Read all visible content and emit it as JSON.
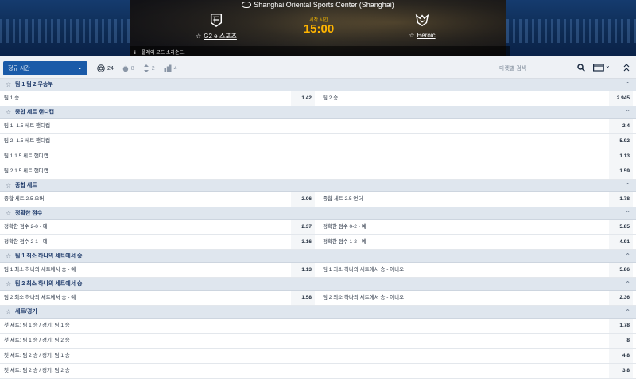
{
  "event": {
    "venue": "Shanghai Oriental Sports Center (Shanghai)",
    "home_team": "G2 e 스포츠",
    "away_team": "Heroic",
    "start_label": "시작 시간",
    "start_time": "15:00",
    "notice": "플레이 모드 소라순드."
  },
  "toolbar": {
    "period": "정규 시간",
    "filters": [
      {
        "count": "24",
        "icon": "target-icon"
      },
      {
        "count": "8",
        "icon": "fire-icon"
      },
      {
        "count": "2",
        "icon": "swap-icon"
      },
      {
        "count": "4",
        "icon": "ladder-icon"
      }
    ],
    "search_placeholder": "마켓별 검색"
  },
  "markets": [
    {
      "title": "팀 1 팀 2 무승부",
      "rows": [
        {
          "left_label": "팀 1 승",
          "left_odd": "1.42",
          "right_label": "팀 2 승",
          "right_odd": "2.945"
        }
      ]
    },
    {
      "title": "종합 세트 핸디캡",
      "rows": [
        {
          "label": "팀 1 -1.5 세트 핸디캡",
          "odd": "2.4"
        },
        {
          "label": "팀 2 -1.5 세트 핸디캡",
          "odd": "5.92"
        },
        {
          "label": "팀 1 1.5 세트 핸디캡",
          "odd": "1.13"
        },
        {
          "label": "팀 2 1.5 세트 핸디캡",
          "odd": "1.59"
        }
      ]
    },
    {
      "title": "종합 세트",
      "rows": [
        {
          "left_label": "종합 세트 2.5 오버",
          "left_odd": "2.06",
          "right_label": "종합 세트 2.5 언더",
          "right_odd": "1.78"
        }
      ]
    },
    {
      "title": "정확한 점수",
      "rows": [
        {
          "left_label": "정확한 점수 2-0 - 예",
          "left_odd": "2.37",
          "right_label": "정확한 점수 0-2 - 예",
          "right_odd": "5.85"
        },
        {
          "left_label": "정확한 점수 2-1 - 예",
          "left_odd": "3.16",
          "right_label": "정확한 점수 1-2 - 예",
          "right_odd": "4.91"
        }
      ]
    },
    {
      "title": "팀 1 최소 하나의 세트에서 승",
      "rows": [
        {
          "left_label": "팀 1 최소 하나의 세트에서 승 - 예",
          "left_odd": "1.13",
          "right_label": "팀 1 최소 하나의 세트에서 승 - 아니오",
          "right_odd": "5.86"
        }
      ]
    },
    {
      "title": "팀 2 최소 하나의 세트에서 승",
      "rows": [
        {
          "left_label": "팀 2 최소 하나의 세트에서 승 - 예",
          "left_odd": "1.58",
          "right_label": "팀 2 최소 하나의 세트에서 승 - 아니오",
          "right_odd": "2.36"
        }
      ]
    },
    {
      "title": "세트/경기",
      "rows": [
        {
          "label": "첫 세트: 팀 1 승 / 경기: 팀 1 승",
          "odd": "1.78"
        },
        {
          "label": "첫 세트: 팀 1 승 / 경기: 팀 2 승",
          "odd": "8"
        },
        {
          "label": "첫 세트: 팀 2 승 / 경기: 팀 1 승",
          "odd": "4.8"
        },
        {
          "label": "첫 세트: 팀 2 승 / 경기: 팀 2 승",
          "odd": "3.8"
        }
      ]
    }
  ],
  "colors": {
    "primary": "#1a5aa8",
    "kickoff": "#ffb400",
    "section_bg": "#dfe6ee"
  }
}
